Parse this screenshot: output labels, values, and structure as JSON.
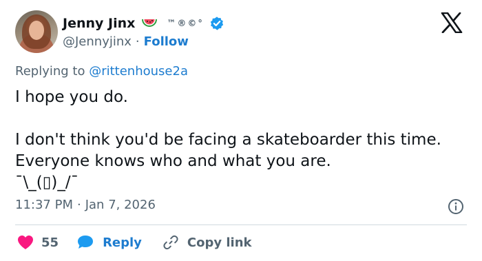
{
  "author": {
    "name": "Jenny Jinx",
    "handle": "@Jennyjinx",
    "name_marks": "™®©°",
    "follow_label": "Follow"
  },
  "reply_context": {
    "prefix": "Replying to",
    "mention": "@rittenhouse2a"
  },
  "tweet": {
    "text": "I hope you do.\n\nI don't think you'd be facing a skateboarder this time. Everyone knows who and what you are.\n¯\\_(▯)_/¯",
    "time": "11:37 PM",
    "date": "Jan 7, 2026"
  },
  "actions": {
    "like_count": "55",
    "reply_label": "Reply",
    "copy_link_label": "Copy link"
  },
  "colors": {
    "accent": "#1d7ccf",
    "like": "#f91880",
    "verified": "#1d9bf0",
    "muted": "#536471"
  },
  "icons": [
    "watermelon-icon",
    "verified-badge-icon",
    "x-logo-icon",
    "info-icon",
    "heart-icon",
    "reply-bubble-icon",
    "link-icon"
  ]
}
